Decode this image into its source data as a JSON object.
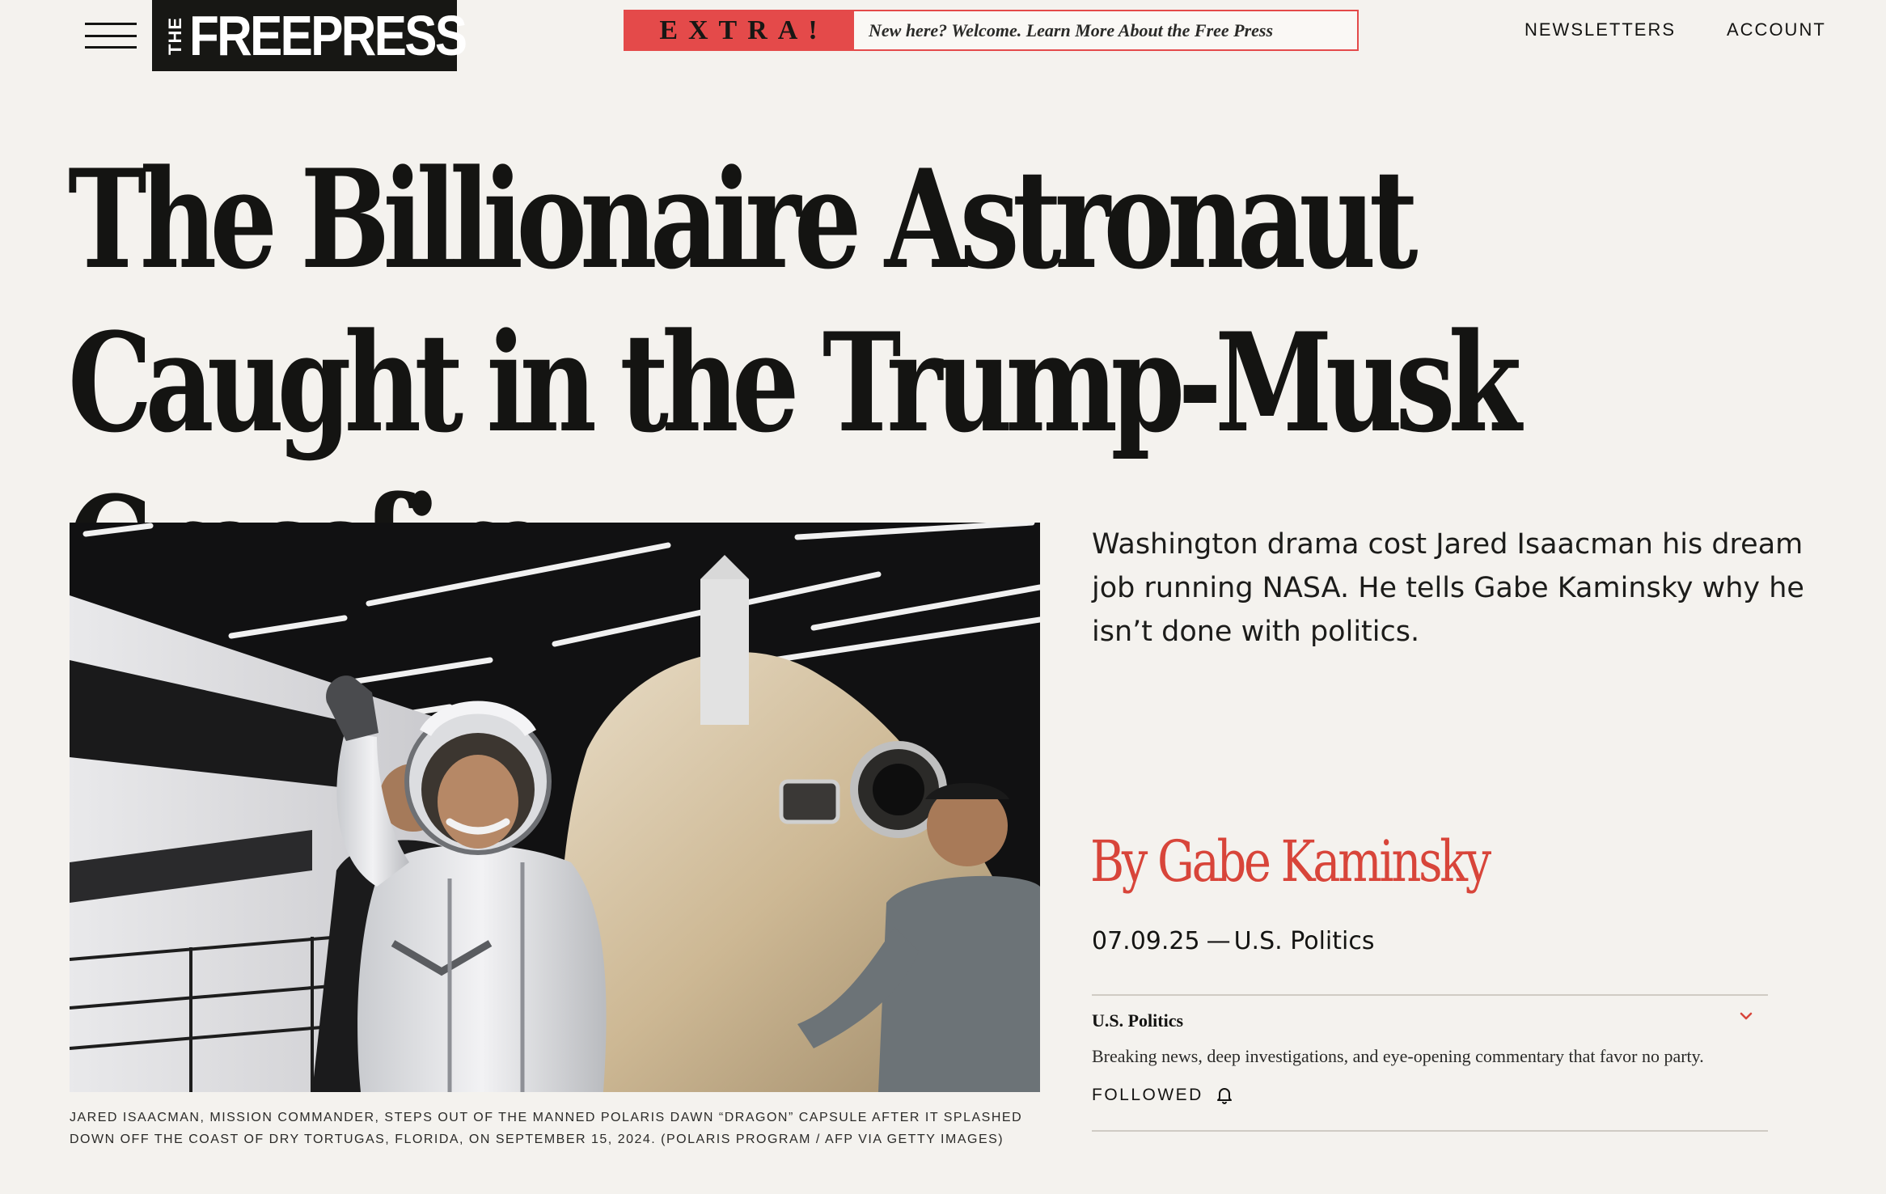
{
  "header": {
    "logo_prefix": "THE",
    "logo_text": "FREEPRESS",
    "extra_badge": "EXTRA!",
    "extra_text": "New here? Welcome. Learn More About the Free Press",
    "nav": {
      "newsletters": "NEWSLETTERS",
      "account": "ACCOUNT"
    }
  },
  "article": {
    "headline": "The Billionaire Astronaut Caught in the Trump-Musk Crossfire",
    "dek": "Washington drama cost Jared Isaacman his dream job running NASA. He tells Gabe Kaminsky why he isn’t done with politics.",
    "byline_prefix": "By",
    "author": "Gabe Kaminsky",
    "date": "07.09.25",
    "separator": "—",
    "section": "U.S. Politics",
    "image_caption": "Jared Isaacman, mission commander, steps out of the manned Polaris Dawn “Dragon” capsule after it splashed down off the coast of Dry Tortugas, Florida, on September 15, 2024. (Polaris Program / AFP via Getty Images)"
  },
  "topic": {
    "title": "U.S. Politics",
    "description": "Breaking news, deep investigations, and eye-opening commentary that favor no party.",
    "follow_status": "FOLLOWED"
  },
  "icons": {
    "menu": "hamburger-menu-icon",
    "chevron": "chevron-down-icon",
    "bell": "bell-icon"
  },
  "colors": {
    "background": "#f4f2ee",
    "accent_red": "#d8453a",
    "extra_red": "#e44a4a",
    "logo_bg": "#171714"
  }
}
